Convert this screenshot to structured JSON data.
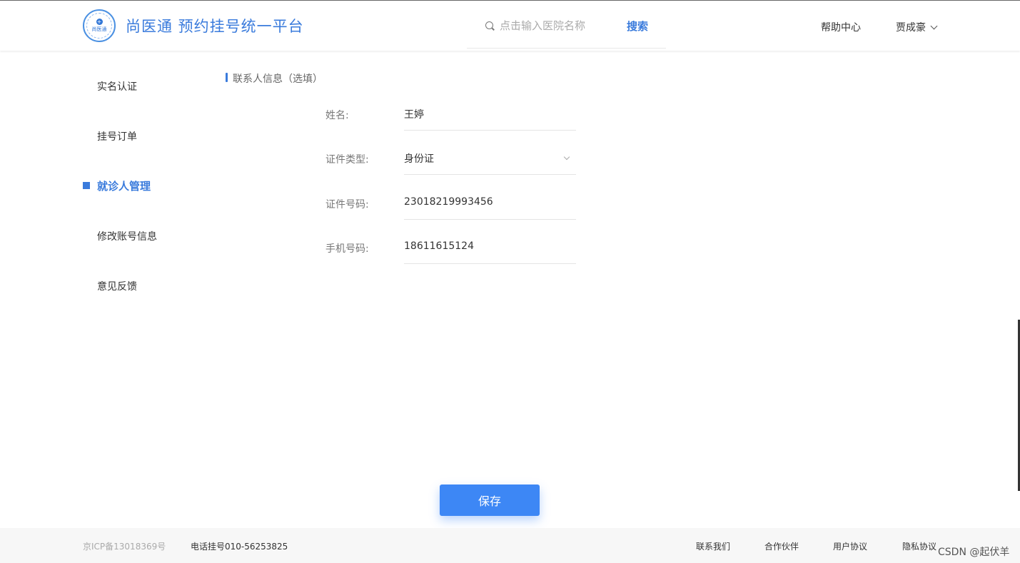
{
  "header": {
    "logo_text": "尚医通",
    "title": "尚医通 预约挂号统一平台",
    "search_placeholder": "点击输入医院名称",
    "search_button": "搜索",
    "help": "帮助中心",
    "user_name": "贾成豪"
  },
  "sidebar": {
    "items": [
      {
        "label": "实名认证"
      },
      {
        "label": "挂号订单"
      },
      {
        "label": "就诊人管理"
      },
      {
        "label": "修改账号信息"
      },
      {
        "label": "意见反馈"
      }
    ],
    "active_index": 2
  },
  "form": {
    "section_title": "联系人信息（选填）",
    "fields": [
      {
        "label": "姓名:",
        "value": "王婷"
      },
      {
        "label": "证件类型:",
        "value": "身份证"
      },
      {
        "label": "证件号码:",
        "value": "23018219993456"
      },
      {
        "label": "手机号码:",
        "value": "18611615124"
      }
    ],
    "save_label": "保存"
  },
  "footer": {
    "icp": "京ICP备13018369号",
    "phone": "电话挂号010-56253825",
    "links": [
      "联系我们",
      "合作伙伴",
      "用户协议",
      "隐私协议"
    ],
    "watermark": "CSDN @起伏羊"
  },
  "colors": {
    "accent": "#3a7bdc",
    "button": "#3d87f5"
  }
}
